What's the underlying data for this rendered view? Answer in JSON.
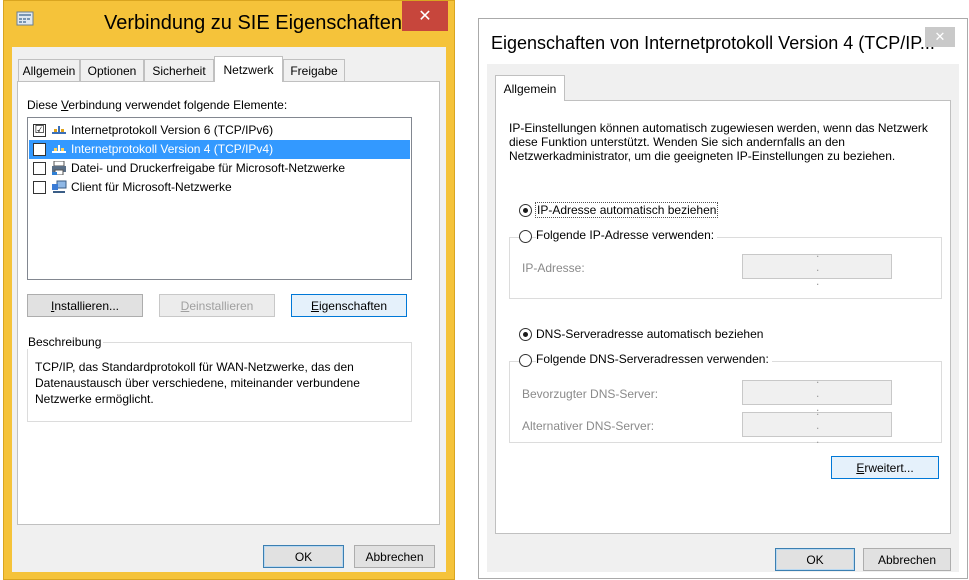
{
  "left_window": {
    "title": "Verbindung zu SIE Eigenschaften",
    "close_glyph": "✕",
    "tabs": [
      {
        "label": "Allgemein"
      },
      {
        "label": "Optionen"
      },
      {
        "label": "Sicherheit"
      },
      {
        "label": "Netzwerk"
      },
      {
        "label": "Freigabe"
      }
    ],
    "active_tab": "Netzwerk",
    "elements_label_pre": "Diese ",
    "elements_label_ul": "V",
    "elements_label_post": "erbindung verwendet folgende Elemente:",
    "items": [
      {
        "label": "Internetprotokoll Version 6 (TCP/IPv6)",
        "checked": "☑",
        "icon": "network-protocol-icon"
      },
      {
        "label": "Internetprotokoll Version 4 (TCP/IPv4)",
        "checked": "☑",
        "icon": "network-protocol-icon"
      },
      {
        "label": "Datei- und Druckerfreigabe für Microsoft-Netzwerke",
        "checked": "",
        "icon": "printer-share-icon"
      },
      {
        "label": "Client für Microsoft-Netzwerke",
        "checked": "",
        "icon": "network-client-icon"
      }
    ],
    "install_ul": "I",
    "install_rest": "nstallieren...",
    "uninstall_ul": "D",
    "uninstall_rest": "einstallieren",
    "properties_ul": "E",
    "properties_rest": "igenschaften",
    "description_title": "Beschreibung",
    "description_text": "TCP/IP, das Standardprotokoll für WAN-Netzwerke, das den Datenaustausch über verschiedene, miteinander verbundene Netzwerke ermöglicht.",
    "ok": "OK",
    "cancel": "Abbrechen"
  },
  "right_window": {
    "title": "Eigenschaften von Internetprotokoll Version 4 (TCP/IP...",
    "close_glyph": "✕",
    "tab": "Allgemein",
    "intro": "IP-Einstellungen können automatisch zugewiesen werden, wenn das Netzwerk diese Funktion unterstützt. Wenden Sie sich andernfalls an den Netzwerkadministrator, um die geeigneten IP-Einstellungen zu beziehen.",
    "ip_auto": "IP-Adresse automatisch beziehen",
    "ip_manual": "Folgende IP-Adresse verwenden:",
    "ip_address_label": "IP-Adresse:",
    "dns_auto": "DNS-Serveradresse automatisch beziehen",
    "dns_manual": "Folgende DNS-Serveradressen verwenden:",
    "dns_preferred_label": "Bevorzugter DNS-Server:",
    "dns_alternate_label": "Alternativer DNS-Server:",
    "ip_dots": ". . .",
    "advanced_ul": "E",
    "advanced_rest": "rweitert...",
    "ok": "OK",
    "cancel": "Abbrechen"
  },
  "colors": {
    "left_frame": "#f5c33a",
    "right_frame": "#ffffff",
    "close_red": "#c7463c",
    "close_inactive": "#c9c9c9",
    "selection": "#3399ff",
    "accent": "#0078d7"
  }
}
